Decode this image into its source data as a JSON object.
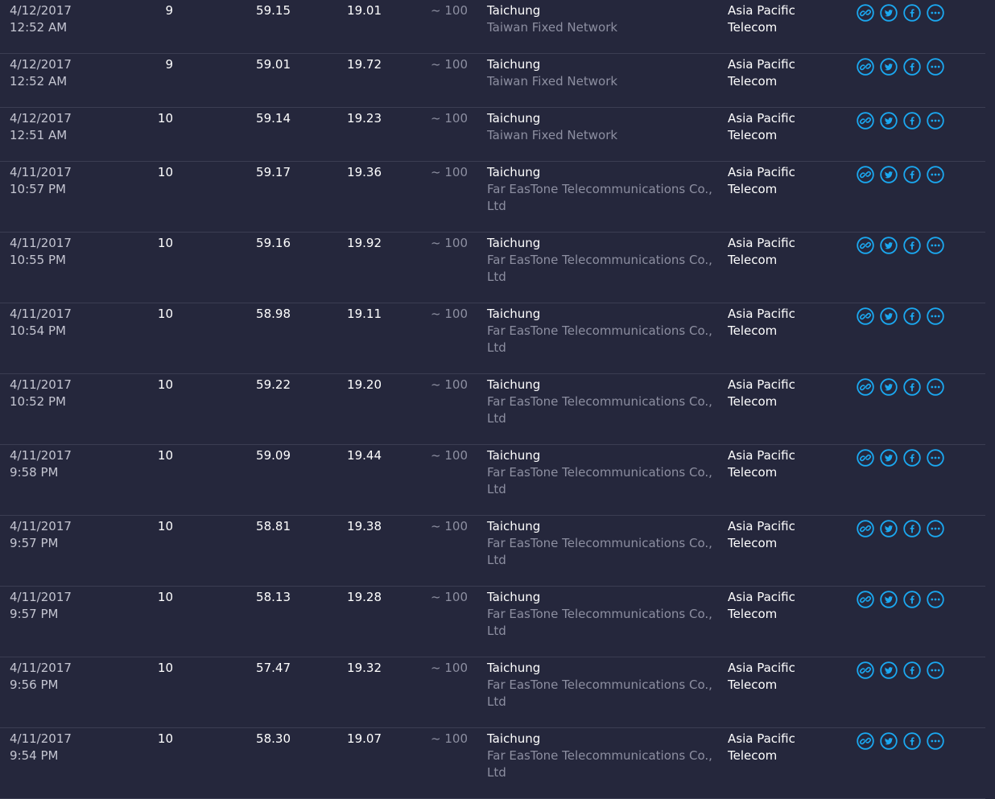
{
  "rows": [
    {
      "date": "4/12/2017",
      "time": "12:52 AM",
      "ping": "9",
      "download": "59.15",
      "upload": "19.01",
      "distance": "~ 100",
      "server_city": "Taichung",
      "server_isp": "Taiwan Fixed Network",
      "provider_line1": "Asia Pacific",
      "provider_line2": "Telecom"
    },
    {
      "date": "4/12/2017",
      "time": "12:52 AM",
      "ping": "9",
      "download": "59.01",
      "upload": "19.72",
      "distance": "~ 100",
      "server_city": "Taichung",
      "server_isp": "Taiwan Fixed Network",
      "provider_line1": "Asia Pacific",
      "provider_line2": "Telecom"
    },
    {
      "date": "4/12/2017",
      "time": "12:51 AM",
      "ping": "10",
      "download": "59.14",
      "upload": "19.23",
      "distance": "~ 100",
      "server_city": "Taichung",
      "server_isp": "Taiwan Fixed Network",
      "provider_line1": "Asia Pacific",
      "provider_line2": "Telecom"
    },
    {
      "date": "4/11/2017",
      "time": "10:57 PM",
      "ping": "10",
      "download": "59.17",
      "upload": "19.36",
      "distance": "~ 100",
      "server_city": "Taichung",
      "server_isp": "Far EasTone Telecommunications Co., Ltd",
      "provider_line1": "Asia Pacific",
      "provider_line2": "Telecom"
    },
    {
      "date": "4/11/2017",
      "time": "10:55 PM",
      "ping": "10",
      "download": "59.16",
      "upload": "19.92",
      "distance": "~ 100",
      "server_city": "Taichung",
      "server_isp": "Far EasTone Telecommunications Co., Ltd",
      "provider_line1": "Asia Pacific",
      "provider_line2": "Telecom"
    },
    {
      "date": "4/11/2017",
      "time": "10:54 PM",
      "ping": "10",
      "download": "58.98",
      "upload": "19.11",
      "distance": "~ 100",
      "server_city": "Taichung",
      "server_isp": "Far EasTone Telecommunications Co., Ltd",
      "provider_line1": "Asia Pacific",
      "provider_line2": "Telecom"
    },
    {
      "date": "4/11/2017",
      "time": "10:52 PM",
      "ping": "10",
      "download": "59.22",
      "upload": "19.20",
      "distance": "~ 100",
      "server_city": "Taichung",
      "server_isp": "Far EasTone Telecommunications Co., Ltd",
      "provider_line1": "Asia Pacific",
      "provider_line2": "Telecom"
    },
    {
      "date": "4/11/2017",
      "time": "9:58 PM",
      "ping": "10",
      "download": "59.09",
      "upload": "19.44",
      "distance": "~ 100",
      "server_city": "Taichung",
      "server_isp": "Far EasTone Telecommunications Co., Ltd",
      "provider_line1": "Asia Pacific",
      "provider_line2": "Telecom"
    },
    {
      "date": "4/11/2017",
      "time": "9:57 PM",
      "ping": "10",
      "download": "58.81",
      "upload": "19.38",
      "distance": "~ 100",
      "server_city": "Taichung",
      "server_isp": "Far EasTone Telecommunications Co., Ltd",
      "provider_line1": "Asia Pacific",
      "provider_line2": "Telecom"
    },
    {
      "date": "4/11/2017",
      "time": "9:57 PM",
      "ping": "10",
      "download": "58.13",
      "upload": "19.28",
      "distance": "~ 100",
      "server_city": "Taichung",
      "server_isp": "Far EasTone Telecommunications Co., Ltd",
      "provider_line1": "Asia Pacific",
      "provider_line2": "Telecom"
    },
    {
      "date": "4/11/2017",
      "time": "9:56 PM",
      "ping": "10",
      "download": "57.47",
      "upload": "19.32",
      "distance": "~ 100",
      "server_city": "Taichung",
      "server_isp": "Far EasTone Telecommunications Co., Ltd",
      "provider_line1": "Asia Pacific",
      "provider_line2": "Telecom"
    },
    {
      "date": "4/11/2017",
      "time": "9:54 PM",
      "ping": "10",
      "download": "58.30",
      "upload": "19.07",
      "distance": "~ 100",
      "server_city": "Taichung",
      "server_isp": "Far EasTone Telecommunications Co., Ltd",
      "provider_line1": "Asia Pacific",
      "provider_line2": "Telecom"
    }
  ],
  "row_actions": [
    "link-icon",
    "twitter-icon",
    "facebook-icon",
    "more-icon"
  ],
  "colors": {
    "background": "#25273c",
    "divider": "#3b3d52",
    "accent": "#1ba8f0",
    "muted_text": "#8d8fa1",
    "date_text": "#c4c5d1"
  }
}
